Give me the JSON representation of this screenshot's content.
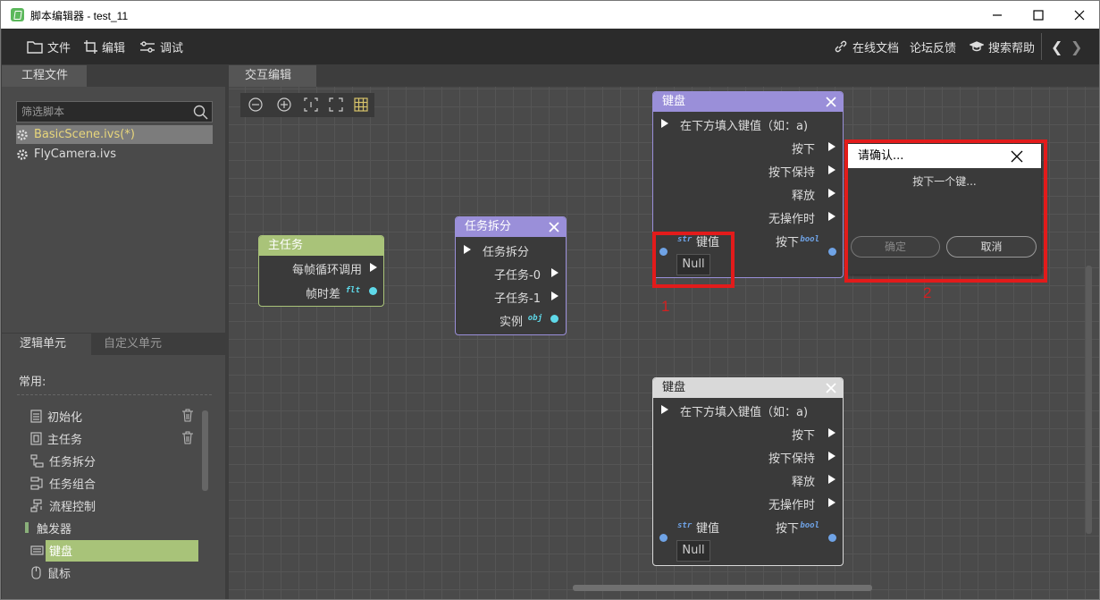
{
  "window": {
    "title": "脚本编辑器 - test_11",
    "minimize_icon": "minimize-icon",
    "maximize_icon": "maximize-icon",
    "close_icon": "close-icon"
  },
  "menu": {
    "file": "文件",
    "edit": "编辑",
    "debug": "调试",
    "online_docs": "在线文档",
    "forum": "论坛反馈",
    "search_help": "搜索帮助",
    "back": "❮",
    "forward": "❯"
  },
  "project": {
    "tab": "工程文件",
    "search_placeholder": "筛选脚本",
    "files": [
      "BasicScene.ivs(*)",
      "FlyCamera.ivs"
    ]
  },
  "units": {
    "tab_logic": "逻辑单元",
    "tab_custom": "自定义单元",
    "common_label": "常用:",
    "items": [
      "初始化",
      "主任务",
      "任务拆分",
      "任务组合",
      "流程控制",
      "触发器",
      "键盘",
      "鼠标"
    ]
  },
  "canvas": {
    "tab": "交互编辑"
  },
  "nodes": {
    "main_task": {
      "title": "主任务",
      "rows": [
        "每帧循环调用",
        "帧时差"
      ],
      "type_tag": "flt"
    },
    "task_split": {
      "title": "任务拆分",
      "rows": [
        "任务拆分",
        "子任务-0",
        "子任务-1",
        "实例"
      ],
      "type_tag": "obj"
    },
    "keyboard1": {
      "title": "键盘",
      "rows": [
        "在下方填入键值（如：a)",
        "按下",
        "按下保持",
        "释放",
        "无操作时",
        "键值",
        "按下"
      ],
      "str_tag": "str",
      "bool_tag": "bool",
      "null_value": "Null"
    },
    "keyboard2": {
      "title": "键盘",
      "rows": [
        "在下方填入键值（如：a)",
        "按下",
        "按下保持",
        "释放",
        "无操作时",
        "键值",
        "按下"
      ],
      "str_tag": "str",
      "bool_tag": "bool",
      "null_value": "Null"
    }
  },
  "dialog": {
    "title": "请确认...",
    "message": "按下一个键...",
    "confirm": "确定",
    "cancel": "取消"
  },
  "annotations": {
    "label1": "1",
    "label2": "2"
  },
  "colors": {
    "main_task_head": "#a9c379",
    "task_split_head": "#9a8fd9",
    "keyboard_head": "#9a8fd9",
    "keyboard2_head": "#d9d9d9",
    "highlight_red": "#e21b1b",
    "selected_item": "#a8c379"
  }
}
